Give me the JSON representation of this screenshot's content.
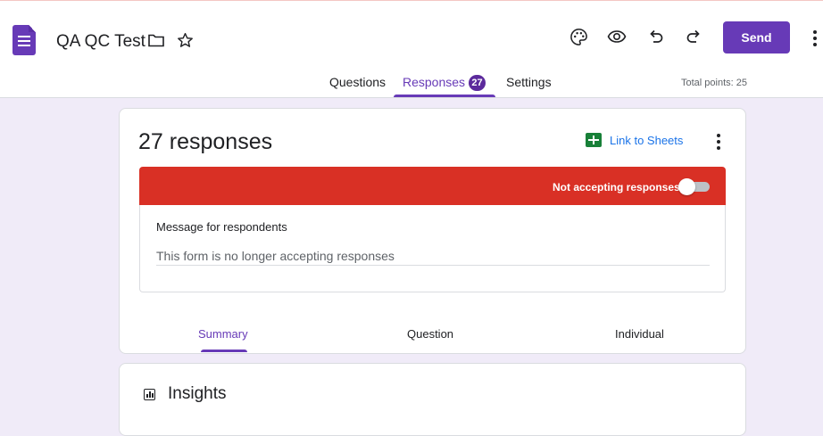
{
  "header": {
    "doc_title": "QA QC Test",
    "send_label": "Send",
    "icons": [
      "forms-app-icon",
      "folder-icon",
      "star-icon",
      "palette-icon",
      "preview-eye-icon",
      "undo-icon",
      "redo-icon",
      "more-vert-icon"
    ]
  },
  "tabs": {
    "questions": "Questions",
    "responses": "Responses",
    "responses_count": "27",
    "settings": "Settings",
    "active": "Responses"
  },
  "total_points": "Total points: 25",
  "responses_card": {
    "title": "27 responses",
    "link_to_sheets": "Link to Sheets",
    "banner_text": "Not accepting responses",
    "accepting": false,
    "message_label": "Message for respondents",
    "message_value": "This form is no longer accepting responses"
  },
  "subtabs": {
    "summary": "Summary",
    "question": "Question",
    "individual": "Individual",
    "active": "Summary"
  },
  "insights": {
    "title": "Insights"
  },
  "colors": {
    "accent": "#673ab7",
    "banner": "#d93025",
    "sheets": "#188038",
    "link": "#1a73e8",
    "background": "#f0ebf8"
  }
}
